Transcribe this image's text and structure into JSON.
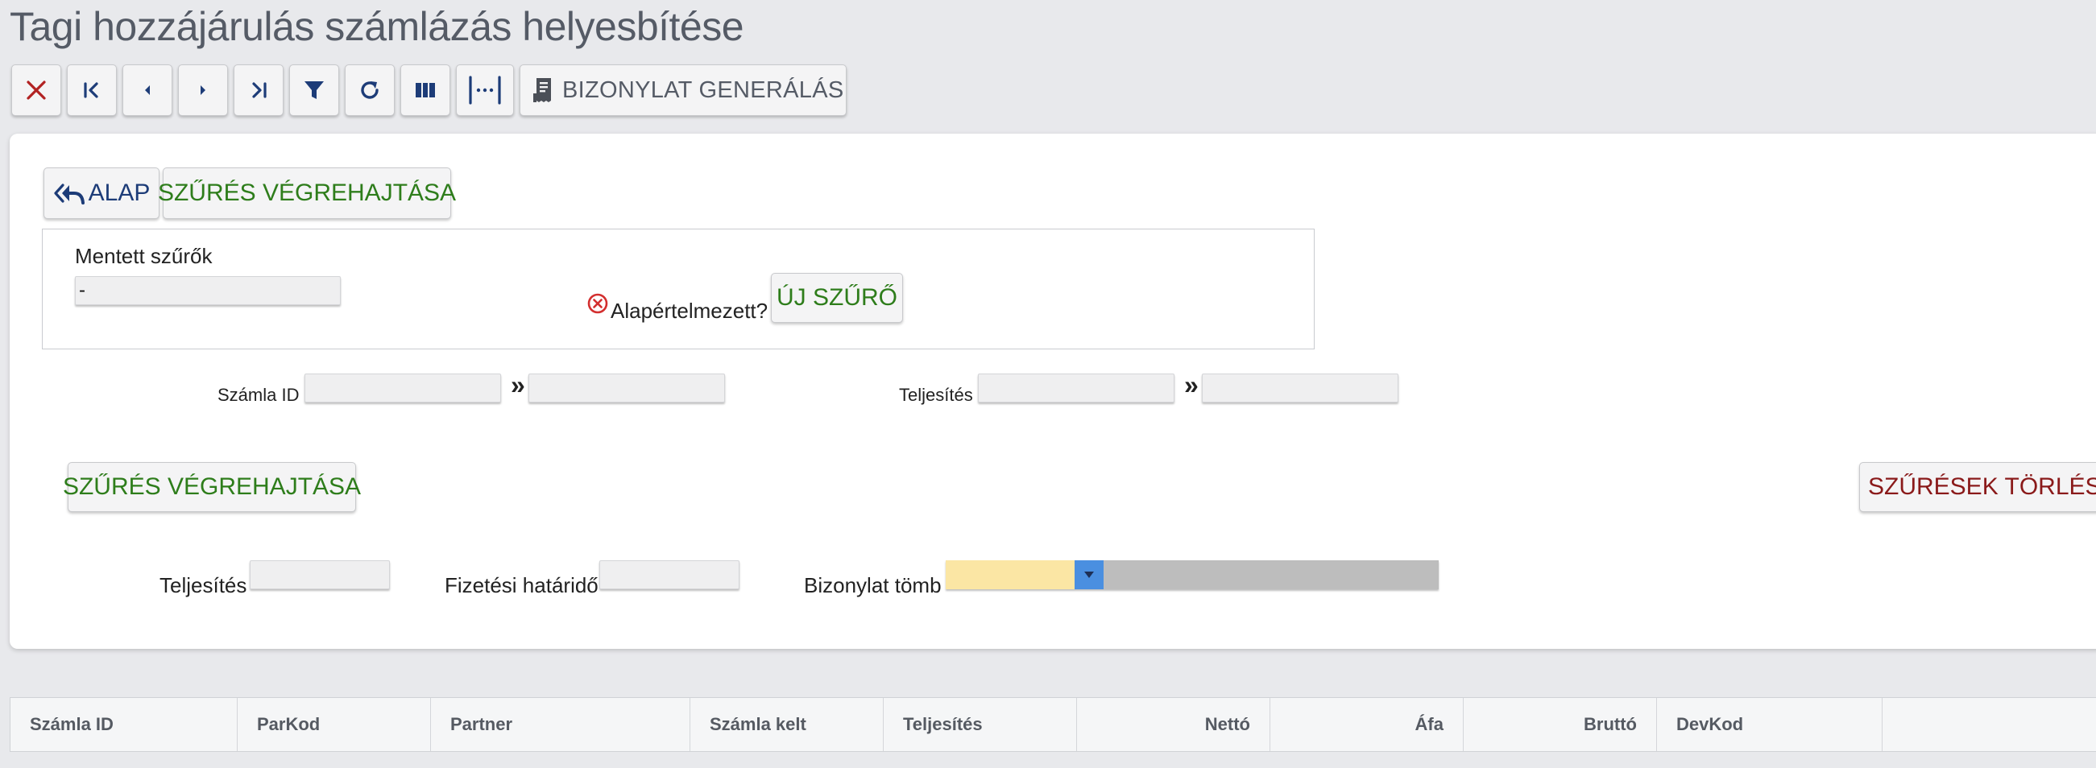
{
  "page": {
    "title": "Tagi hozzájárulás számlázás helyesbítése"
  },
  "toolbar": {
    "buttons": [
      {
        "name": "close-button",
        "icon": "close-icon"
      },
      {
        "name": "first-record-button",
        "icon": "first-icon"
      },
      {
        "name": "prev-record-button",
        "icon": "prev-icon"
      },
      {
        "name": "next-record-button",
        "icon": "next-icon"
      },
      {
        "name": "last-record-button",
        "icon": "last-icon"
      },
      {
        "name": "filter-button",
        "icon": "filter-icon"
      },
      {
        "name": "refresh-button",
        "icon": "refresh-icon"
      },
      {
        "name": "columns-button",
        "icon": "columns-icon"
      },
      {
        "name": "column-width-button",
        "icon": "column-width-icon"
      }
    ],
    "generate_label": "BIZONYLAT GENERÁLÁS",
    "generate_icon": "document-icon"
  },
  "filter": {
    "alap_label": "ALAP",
    "alap_icon": "reply-all-icon",
    "execute_top_label": "SZŰRÉS VÉGREHAJTÁSA",
    "saved_filters_label": "Mentett szűrők",
    "saved_filters_value": "-",
    "default_label": "Alapértelmezett?",
    "default_icon": "circle-x-icon",
    "new_filter_label": "ÚJ SZŰRŐ",
    "szamla_id_label": "Számla ID",
    "teljesites_range_label": "Teljesítés",
    "range_separator": "»",
    "execute_bottom_label": "SZŰRÉS VÉGREHAJTÁSA",
    "clear_filters_label": "SZŰRÉSEK TÖRLÉSE",
    "teljesites_label": "Teljesítés",
    "fizetesi_hatarido_label": "Fizetési határidő",
    "bizonylat_tomb_label": "Bizonylat tömb"
  },
  "colors": {
    "accent": "#1d3c78",
    "execute": "#2e7d1b",
    "clear": "#8a1a1a",
    "close": "#b22222",
    "combo_value": "#fbe6a4",
    "combo_arrow": "#4a8fe0"
  },
  "grid": {
    "columns": [
      "Számla ID",
      "ParKod",
      "Partner",
      "Számla kelt",
      "Teljesítés",
      "Nettó",
      "Áfa",
      "Bruttó",
      "DevKod"
    ]
  }
}
